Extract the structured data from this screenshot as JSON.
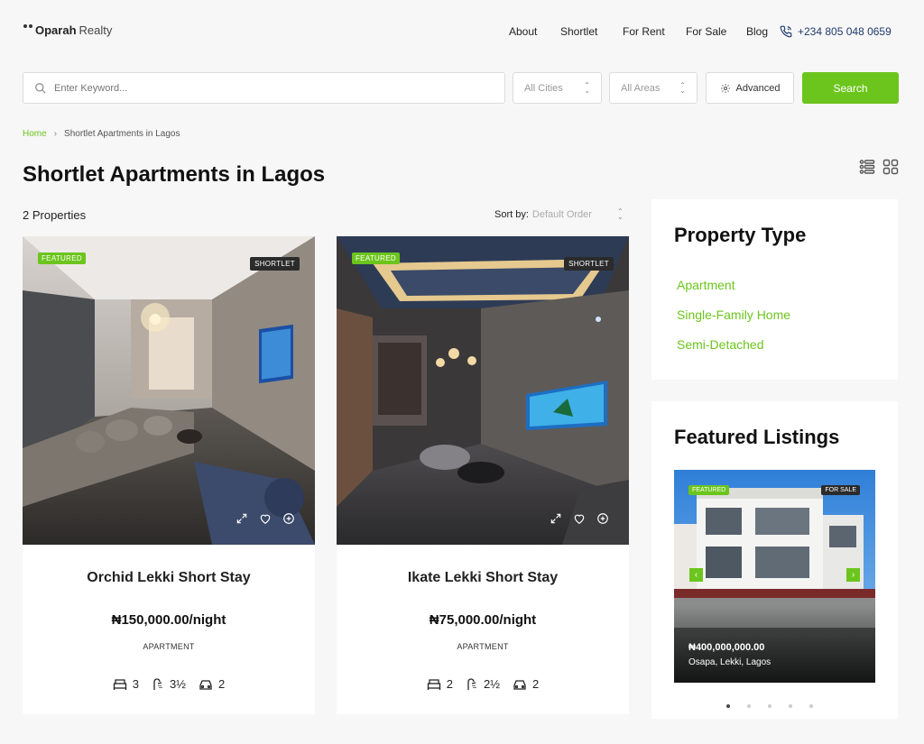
{
  "brand": {
    "logo_bold": "Oparah",
    "logo_light": "Realty"
  },
  "nav": {
    "about": "About",
    "shortlet": "Shortlet",
    "rent": "For Rent",
    "sale": "For Sale",
    "blog": "Blog",
    "phone": "+234 805 048 0659"
  },
  "search": {
    "placeholder": "Enter Keyword...",
    "cities": "All Cities",
    "areas": "All Areas",
    "advanced": "Advanced",
    "button": "Search"
  },
  "breadcrumb": {
    "home": "Home",
    "current": "Shortlet Apartments in Lagos"
  },
  "page": {
    "title": "Shortlet Apartments in Lagos",
    "count": "2 Properties",
    "sort_label": "Sort by:",
    "sort_value": "Default Order"
  },
  "listings": [
    {
      "badge": "FEATURED",
      "label": "SHORTLET",
      "title": "Orchid Lekki Short Stay",
      "price": "₦150,000.00/night",
      "type": "APARTMENT",
      "beds": "3",
      "baths": "3½",
      "garages": "2"
    },
    {
      "badge": "FEATURED",
      "label": "SHORTLET",
      "title": "Ikate Lekki Short Stay",
      "price": "₦75,000.00/night",
      "type": "APARTMENT",
      "beds": "2",
      "baths": "2½",
      "garages": "2"
    }
  ],
  "sidebar": {
    "property_type_title": "Property Type",
    "property_types": [
      "Apartment",
      "Single-Family Home",
      "Semi-Detached"
    ],
    "featured_title": "Featured Listings",
    "featured": {
      "badge": "FEATURED",
      "status": "FOR SALE",
      "price": "₦400,000,000.00",
      "location": "Osapa, Lekki, Lagos"
    }
  },
  "colors": {
    "accent": "#6cc51d",
    "phone": "#1e3a6e"
  }
}
